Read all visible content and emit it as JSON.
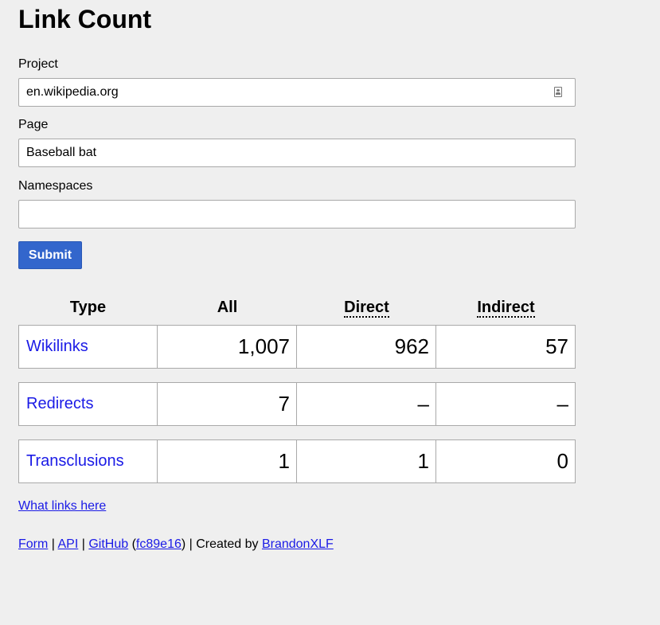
{
  "title": "Link Count",
  "form": {
    "project_label": "Project",
    "project_value": "en.wikipedia.org",
    "page_label": "Page",
    "page_value": "Baseball bat",
    "namespaces_label": "Namespaces",
    "namespaces_value": "",
    "submit_label": "Submit"
  },
  "table": {
    "headers": [
      "Type",
      "All",
      "Direct",
      "Indirect"
    ],
    "rows": [
      {
        "type": "Wikilinks",
        "all": "1,007",
        "direct": "962",
        "indirect": "57"
      },
      {
        "type": "Redirects",
        "all": "7",
        "direct": "–",
        "indirect": "–"
      },
      {
        "type": "Transclusions",
        "all": "1",
        "direct": "1",
        "indirect": "0"
      }
    ]
  },
  "what_links_here": "What links here",
  "footer": {
    "form": "Form",
    "sep1": " | ",
    "api": "API",
    "sep2": " | ",
    "github": "GitHub",
    "paren_open": " (",
    "commit": "fc89e16",
    "paren_close": ")",
    "created_by": " | Created by ",
    "author": "BrandonXLF"
  }
}
